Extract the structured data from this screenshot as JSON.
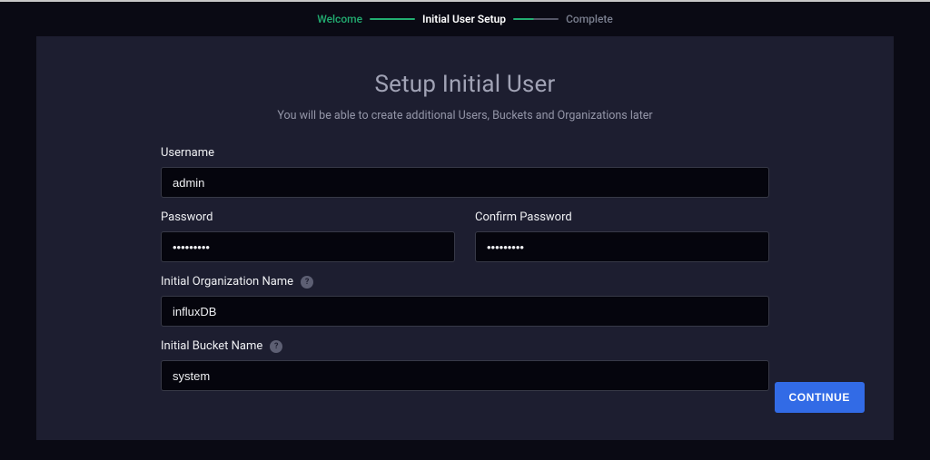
{
  "wizard": {
    "steps": [
      {
        "label": "Welcome",
        "state": "done"
      },
      {
        "label": "Initial User Setup",
        "state": "active"
      },
      {
        "label": "Complete",
        "state": "pending"
      }
    ]
  },
  "page": {
    "title": "Setup Initial User",
    "subtitle": "You will be able to create additional Users, Buckets and Organizations later"
  },
  "form": {
    "username": {
      "label": "Username",
      "value": "admin"
    },
    "password": {
      "label": "Password",
      "value": "•••••••••"
    },
    "confirm_password": {
      "label": "Confirm Password",
      "value": "•••••••••"
    },
    "org": {
      "label": "Initial Organization Name",
      "value": "influxDB",
      "help": "?"
    },
    "bucket": {
      "label": "Initial Bucket Name",
      "value": "system",
      "help": "?"
    }
  },
  "actions": {
    "continue": "CONTINUE"
  }
}
